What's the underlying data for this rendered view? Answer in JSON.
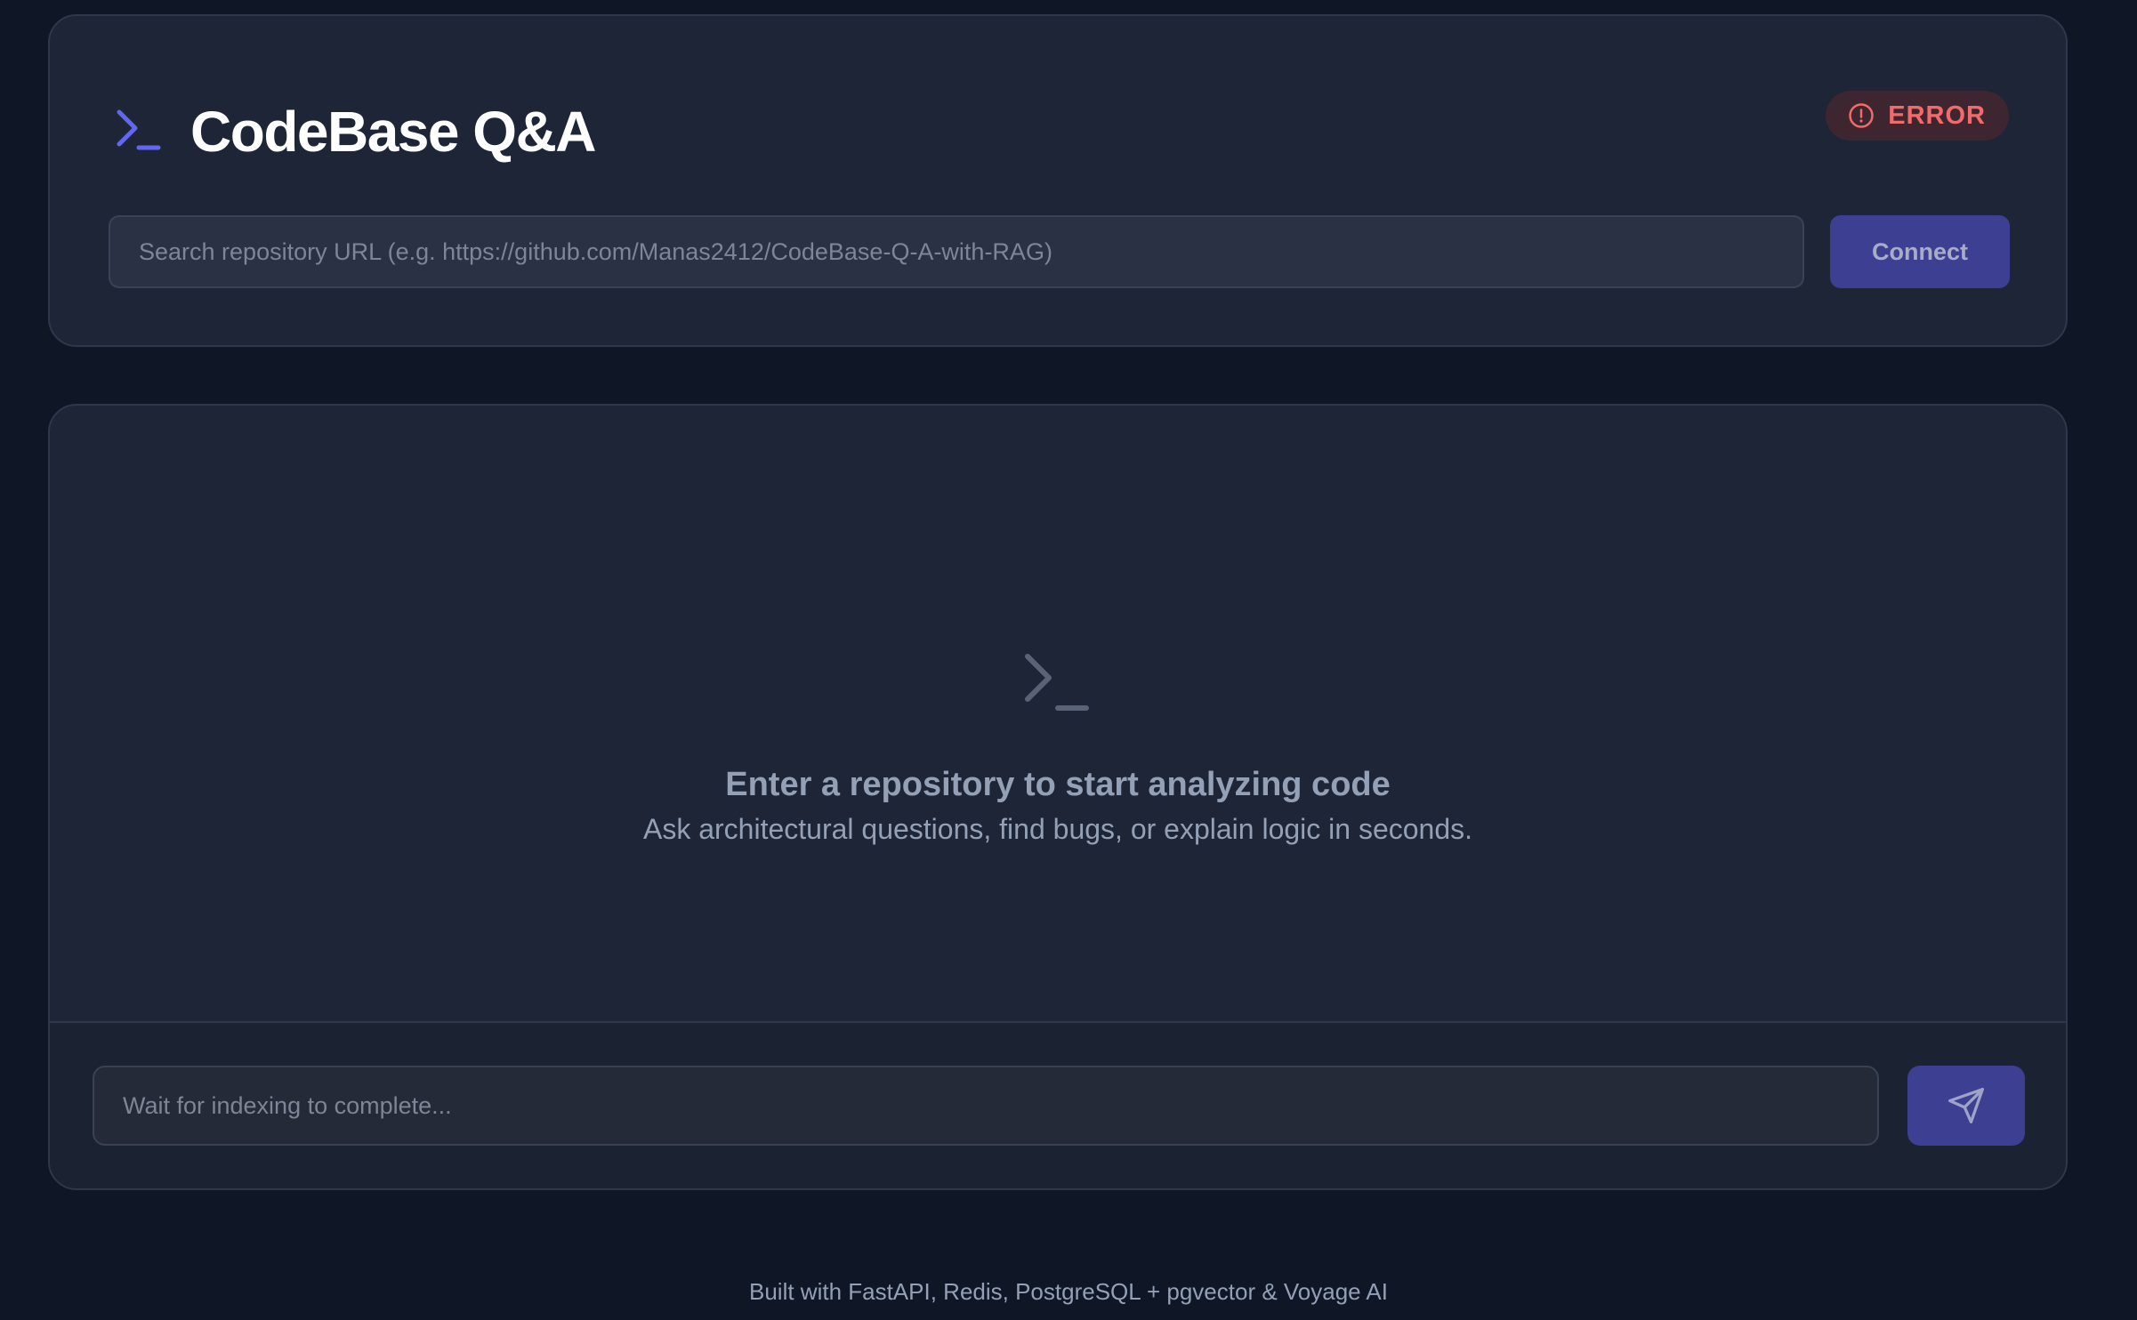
{
  "header": {
    "title": "CodeBase Q&A",
    "logo_icon": "terminal-prompt-icon",
    "status": {
      "label": "ERROR",
      "icon": "alert-circle-icon",
      "color": "#f26a6a"
    }
  },
  "repo_search": {
    "placeholder": "Search repository URL (e.g. https://github.com/Manas2412/CodeBase-Q-A-with-RAG)",
    "value": "",
    "connect_label": "Connect"
  },
  "chat": {
    "empty_state": {
      "icon": "terminal-prompt-icon",
      "title": "Enter a repository to start analyzing code",
      "subtitle": "Ask architectural questions, find bugs, or explain logic in seconds."
    },
    "composer": {
      "placeholder": "Wait for indexing to complete...",
      "value": "",
      "send_icon": "send-icon"
    }
  },
  "footer": {
    "text": "Built with FastAPI, Redis, PostgreSQL + pgvector & Voyage AI"
  },
  "colors": {
    "background": "#0f1626",
    "card": "#1e2536",
    "accent": "#3c3f92",
    "brand_icon": "#6366f1",
    "error": "#f26a6a"
  }
}
